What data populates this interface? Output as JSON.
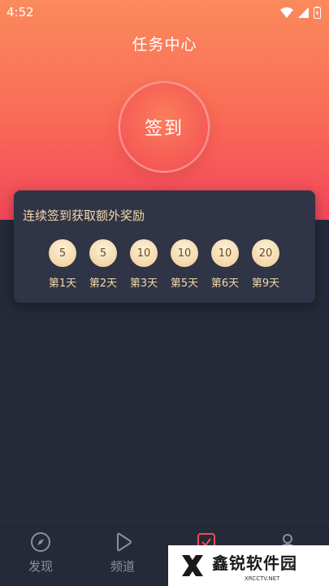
{
  "status_bar": {
    "time": "4:52"
  },
  "header": {
    "title": "任务中心"
  },
  "sign_in": {
    "label": "签到"
  },
  "bonus": {
    "title": "连续签到获取额外奖励",
    "items": [
      {
        "value": "5",
        "day": "第1天"
      },
      {
        "value": "5",
        "day": "第2天"
      },
      {
        "value": "10",
        "day": "第3天"
      },
      {
        "value": "10",
        "day": "第5天"
      },
      {
        "value": "10",
        "day": "第6天"
      },
      {
        "value": "20",
        "day": "第9天"
      }
    ]
  },
  "tabs": [
    {
      "label": "发现",
      "icon": "compass-icon"
    },
    {
      "label": "频道",
      "icon": "play-icon"
    },
    {
      "label": "",
      "icon": "checkbox-icon"
    },
    {
      "label": "",
      "icon": "person-icon"
    }
  ],
  "watermark": {
    "main": "鑫锐软件园",
    "sub": "XRCCTV.NET"
  },
  "colors": {
    "header_top": "#fb8a5c",
    "header_bottom": "#f1465a",
    "background": "#252a38",
    "card": "#2f3446",
    "gold": "#f3d7a8",
    "tab_active": "#f04c57"
  }
}
